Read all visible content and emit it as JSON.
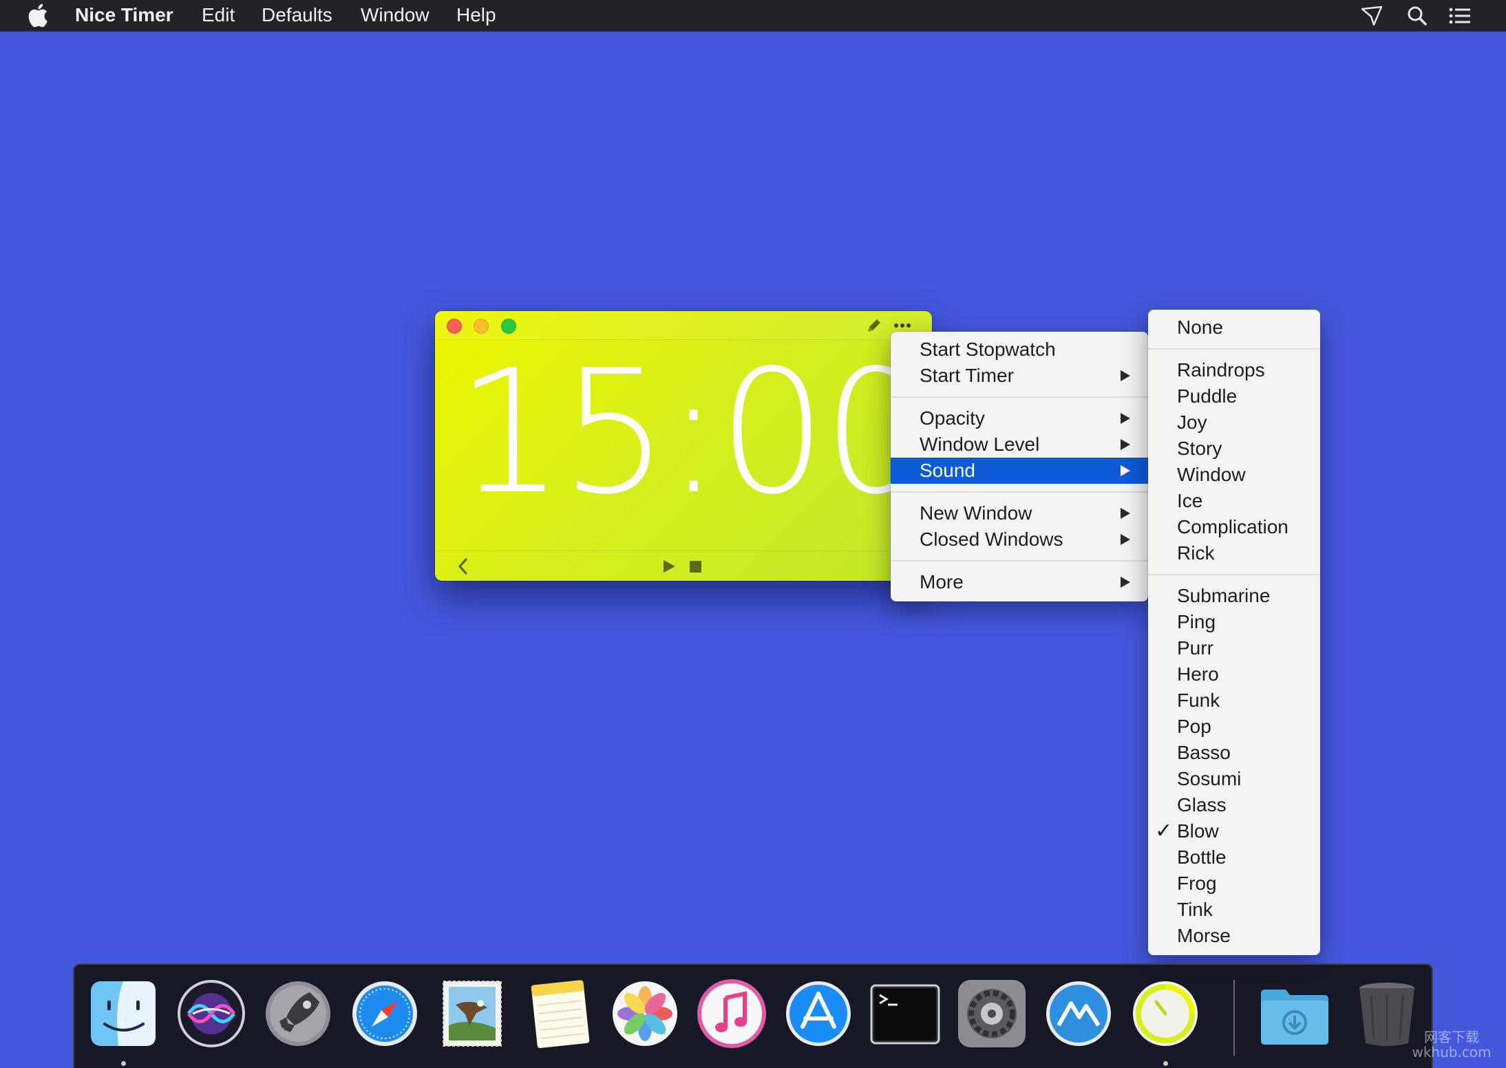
{
  "menubar": {
    "app_name": "Nice Timer",
    "menus": [
      "Edit",
      "Defaults",
      "Window",
      "Help"
    ],
    "status_icons": [
      "paper-plane-icon",
      "search-icon",
      "list-icon"
    ]
  },
  "timer_window": {
    "display": "15:00",
    "color": "#e1f10f",
    "titlebar_icons": [
      "pencil-icon",
      "ellipsis-icon"
    ],
    "controls": [
      "back-chevron-icon",
      "play-icon",
      "stop-icon"
    ]
  },
  "context_menu": {
    "items": [
      {
        "label": "Start Stopwatch",
        "submenu": false
      },
      {
        "label": "Start Timer",
        "submenu": true
      },
      {
        "label": "Opacity",
        "submenu": true
      },
      {
        "label": "Window Level",
        "submenu": true
      },
      {
        "label": "Sound",
        "submenu": true,
        "selected": true
      },
      {
        "label": "New Window",
        "submenu": true
      },
      {
        "label": "Closed Windows",
        "submenu": true
      },
      {
        "label": "More",
        "submenu": true
      }
    ]
  },
  "sound_menu": {
    "checked_mark": "✓",
    "groups": [
      [
        "None"
      ],
      [
        "Raindrops",
        "Puddle",
        "Joy",
        "Story",
        "Window",
        "Ice",
        "Complication",
        "Rick"
      ],
      [
        "Submarine",
        "Ping",
        "Purr",
        "Hero",
        "Funk",
        "Pop",
        "Basso",
        "Sosumi",
        "Glass",
        "Blow",
        "Bottle",
        "Frog",
        "Tink",
        "Morse"
      ]
    ],
    "checked": "Blow"
  },
  "dock": {
    "apps": [
      "finder-icon",
      "siri-icon",
      "launchpad-icon",
      "safari-icon",
      "mail-icon",
      "notes-icon",
      "photos-icon",
      "itunes-icon",
      "app-store-icon",
      "terminal-icon",
      "system-preferences-icon",
      "instruments-icon",
      "nice-timer-icon",
      "downloads-folder-icon",
      "trash-icon"
    ],
    "running": [
      "finder-icon",
      "nice-timer-icon"
    ]
  },
  "watermark": {
    "line1": "网客下载",
    "line2": "wkhub.com"
  },
  "colors": {
    "desktop": "#4458dc",
    "menu_highlight": "#0d5bd7",
    "timer_green": "#e1f10f"
  }
}
